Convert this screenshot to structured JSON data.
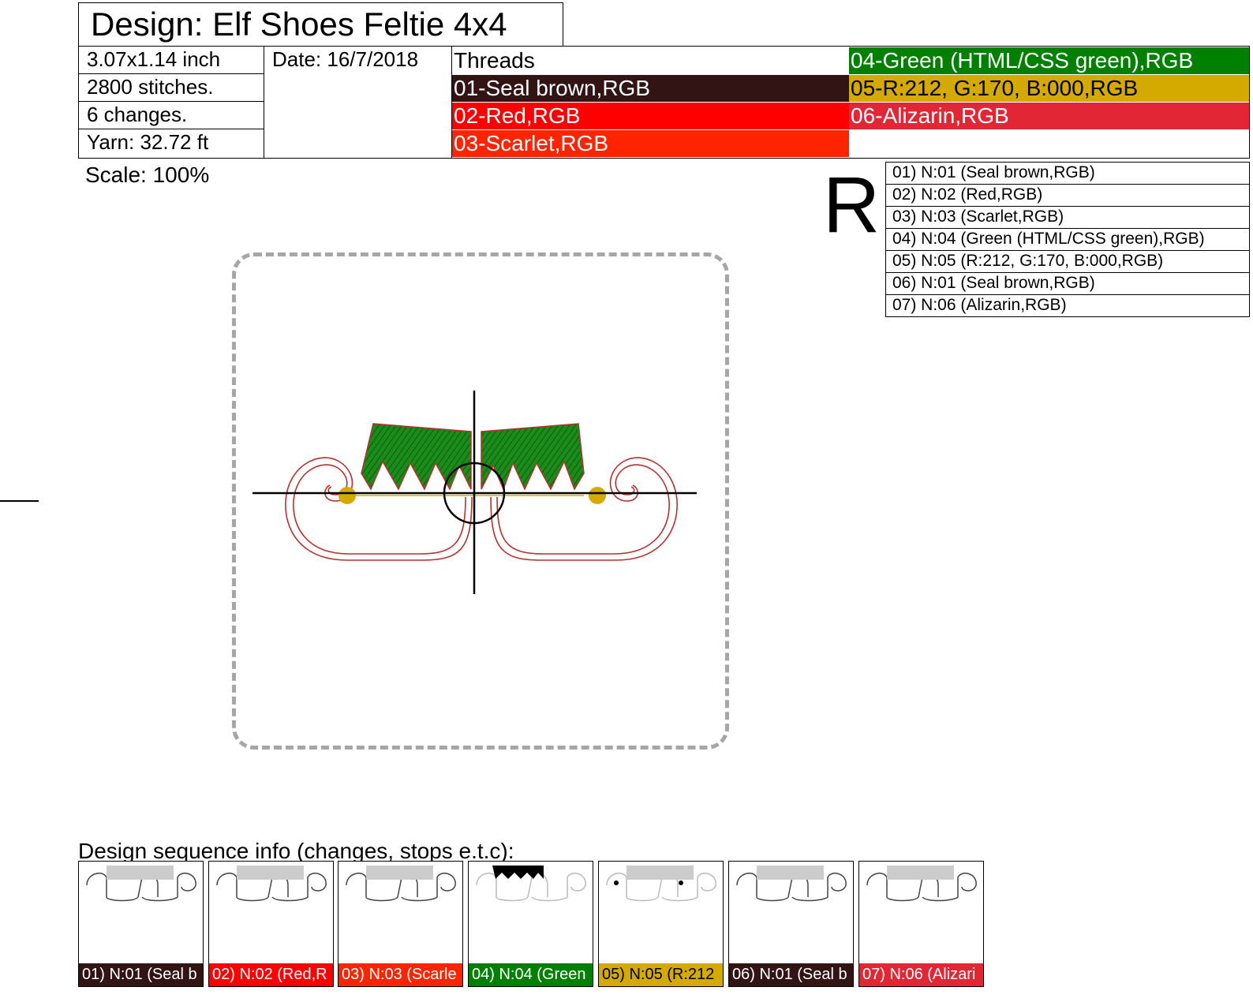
{
  "header": {
    "title": "Design: Elf Shoes Feltie 4x4",
    "size": "3.07x1.14 inch",
    "date": "Date: 16/7/2018",
    "stitches": "2800 stitches.",
    "changes": "6 changes.",
    "yarn": "Yarn: 32.72 ft",
    "threads_label": "Threads"
  },
  "threads": [
    {
      "label": "01-Seal brown,RGB",
      "color": "#321414",
      "text_color": "#ffffff"
    },
    {
      "label": "02-Red,RGB",
      "color": "#ff0000",
      "text_color": "#ffffff"
    },
    {
      "label": "03-Scarlet,RGB",
      "color": "#ff2400",
      "text_color": "#ffffff"
    },
    {
      "label": "04-Green (HTML/CSS green),RGB",
      "color": "#008000",
      "text_color": "#ffffff"
    },
    {
      "label": "05-R:212, G:170, B:000,RGB",
      "color": "#d4aa00",
      "text_color": "#000000"
    },
    {
      "label": "06-Alizarin,RGB",
      "color": "#e32636",
      "text_color": "#ffffff"
    }
  ],
  "scale": "Scale: 100%",
  "rotation_mark": "R",
  "sequence": [
    "01) N:01 (Seal brown,RGB)",
    "02) N:02 (Red,RGB)",
    "03) N:03 (Scarlet,RGB)",
    "04) N:04 (Green (HTML/CSS green),RGB)",
    "05) N:05 (R:212, G:170, B:000,RGB)",
    "06) N:01 (Seal brown,RGB)",
    "07) N:06 (Alizarin,RGB)"
  ],
  "sequence_title": "Design sequence info (changes, stops e.t.c):",
  "thumbnails": [
    {
      "label": "01) N:01 (Seal b",
      "color": "#321414",
      "text_color": "#ffffff"
    },
    {
      "label": "02) N:02 (Red,R",
      "color": "#ff0000",
      "text_color": "#ffffff"
    },
    {
      "label": "03) N:03 (Scarle",
      "color": "#ff2400",
      "text_color": "#ffffff"
    },
    {
      "label": "04) N:04 (Green",
      "color": "#008000",
      "text_color": "#ffffff"
    },
    {
      "label": "05) N:05 (R:212",
      "color": "#d4aa00",
      "text_color": "#000000"
    },
    {
      "label": "06) N:01 (Seal b",
      "color": "#321414",
      "text_color": "#ffffff"
    },
    {
      "label": "07) N:06 (Alizari",
      "color": "#e32636",
      "text_color": "#ffffff"
    }
  ]
}
